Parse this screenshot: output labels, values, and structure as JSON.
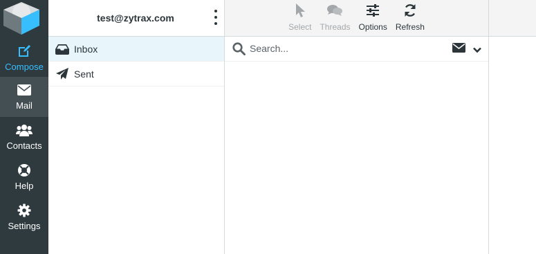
{
  "nav": {
    "items": [
      {
        "label": "Compose",
        "icon": "compose-icon"
      },
      {
        "label": "Mail",
        "icon": "envelope-icon"
      },
      {
        "label": "Contacts",
        "icon": "users-icon"
      },
      {
        "label": "Help",
        "icon": "lifebuoy-icon"
      },
      {
        "label": "Settings",
        "icon": "gear-icon"
      }
    ],
    "active": "Mail"
  },
  "account": {
    "email": "test@zytrax.com"
  },
  "folders": [
    {
      "label": "Inbox",
      "icon": "inbox-icon",
      "selected": true
    },
    {
      "label": "Sent",
      "icon": "paper-plane-icon",
      "selected": false
    }
  ],
  "toolbar": {
    "buttons": [
      {
        "label": "Select",
        "icon": "cursor-icon",
        "enabled": false
      },
      {
        "label": "Threads",
        "icon": "comments-icon",
        "enabled": false
      },
      {
        "label": "Options",
        "icon": "sliders-icon",
        "enabled": true
      },
      {
        "label": "Refresh",
        "icon": "refresh-icon",
        "enabled": true
      }
    ]
  },
  "search": {
    "placeholder": "Search..."
  },
  "colors": {
    "nav_bg": "#2f3a3f",
    "nav_active_bg": "#444f54",
    "accent": "#37beff",
    "selected_folder_bg": "#e8f6fc",
    "toolbar_bg": "#f4f4f4"
  }
}
